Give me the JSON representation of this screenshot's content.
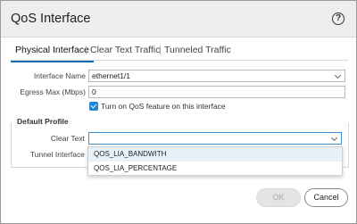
{
  "dialog": {
    "title": "QoS Interface",
    "help_glyph": "?"
  },
  "tabs": [
    {
      "label": "Physical Interface",
      "active": true
    },
    {
      "label": "Clear Text Traffic",
      "active": false
    },
    {
      "label": "Tunneled Traffic",
      "active": false
    }
  ],
  "tab_separator": "|",
  "form": {
    "interface_name": {
      "label": "Interface Name",
      "value": "ethernet1/1"
    },
    "egress_max": {
      "label": "Egress Max (Mbps)",
      "value": "0"
    },
    "qos_checkbox": {
      "label": "Turn on QoS feature on this interface",
      "checked": true
    }
  },
  "default_profile": {
    "legend": "Default Profile",
    "clear_text": {
      "label": "Clear Text",
      "value": ""
    },
    "tunnel_interface": {
      "label": "Tunnel Interface"
    }
  },
  "dropdown_options": [
    "QOS_LIA_BANDWITH",
    "QOS_LIA_PERCENTAGE"
  ],
  "buttons": {
    "ok": "OK",
    "cancel": "Cancel"
  },
  "colors": {
    "accent": "#0e6fb0",
    "checkbox": "#1e88d2",
    "focus_border": "#3d8fd6"
  }
}
